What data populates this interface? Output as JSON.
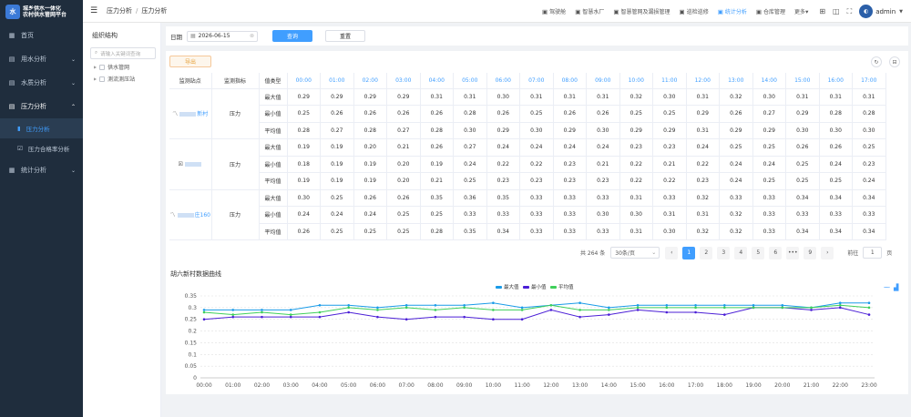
{
  "app": {
    "title_line1": "城乡供水一体化",
    "title_line2": "农村供水管网平台",
    "logo_mark": "水"
  },
  "sidebar": {
    "items": [
      {
        "label": "首页",
        "icon": "home-icon",
        "glyph": "▦"
      },
      {
        "label": "用水分析",
        "icon": "water-icon",
        "glyph": "▤"
      },
      {
        "label": "水质分析",
        "icon": "quality-icon",
        "glyph": "▤"
      },
      {
        "label": "压力分析",
        "icon": "pressure-icon",
        "glyph": "▤"
      },
      {
        "label": "统计分析",
        "icon": "stats-icon",
        "glyph": "▦"
      }
    ],
    "subitems": [
      {
        "label": "压力分析",
        "glyph": "▮"
      },
      {
        "label": "压力合格率分析",
        "glyph": "☑"
      }
    ]
  },
  "topbar": {
    "breadcrumb": [
      "压力分析",
      "压力分析"
    ],
    "nav": [
      {
        "label": "驾驶舱",
        "glyph": "▣"
      },
      {
        "label": "智慧水厂",
        "glyph": "▣"
      },
      {
        "label": "智慧管网及漏损管理",
        "glyph": "▣"
      },
      {
        "label": "巡检巡修",
        "glyph": "▣"
      },
      {
        "label": "统计分析",
        "glyph": "▣"
      },
      {
        "label": "仓库管理",
        "glyph": "▣"
      },
      {
        "label": "更多",
        "glyph": "▾"
      }
    ],
    "user": "admin"
  },
  "tree": {
    "title": "组织结构",
    "search_placeholder": "请输入关键词查询",
    "nodes": [
      "供水管网",
      "测流测压站"
    ]
  },
  "filter": {
    "date_label": "日期",
    "date_value": "2026-06-15",
    "query": "查询",
    "reset": "重置"
  },
  "table": {
    "export": "导出",
    "headers": [
      "监测站点",
      "监测指标",
      "值类型"
    ],
    "hours": [
      "00:00",
      "01:00",
      "02:00",
      "03:00",
      "04:00",
      "05:00",
      "06:00",
      "07:00",
      "08:00",
      "09:00",
      "10:00",
      "11:00",
      "12:00",
      "13:00",
      "14:00",
      "15:00",
      "16:00",
      "17:00"
    ],
    "groups": [
      {
        "site": "新村",
        "metric": "压力",
        "rows": [
          {
            "type": "最大值",
            "values": [
              "0.29",
              "0.29",
              "0.29",
              "0.29",
              "0.31",
              "0.31",
              "0.30",
              "0.31",
              "0.31",
              "0.31",
              "0.32",
              "0.30",
              "0.31",
              "0.32",
              "0.30",
              "0.31",
              "0.31",
              "0.31"
            ]
          },
          {
            "type": "最小值",
            "values": [
              "0.25",
              "0.26",
              "0.26",
              "0.26",
              "0.26",
              "0.28",
              "0.26",
              "0.25",
              "0.26",
              "0.26",
              "0.25",
              "0.25",
              "0.29",
              "0.26",
              "0.27",
              "0.29",
              "0.28",
              "0.28"
            ]
          },
          {
            "type": "平均值",
            "values": [
              "0.28",
              "0.27",
              "0.28",
              "0.27",
              "0.28",
              "0.30",
              "0.29",
              "0.30",
              "0.29",
              "0.30",
              "0.29",
              "0.29",
              "0.31",
              "0.29",
              "0.29",
              "0.30",
              "0.30",
              "0.30"
            ]
          }
        ]
      },
      {
        "site": "",
        "metric": "压力",
        "rows": [
          {
            "type": "最大值",
            "values": [
              "0.19",
              "0.19",
              "0.20",
              "0.21",
              "0.26",
              "0.27",
              "0.24",
              "0.24",
              "0.24",
              "0.24",
              "0.23",
              "0.23",
              "0.24",
              "0.25",
              "0.25",
              "0.26",
              "0.26",
              "0.25"
            ]
          },
          {
            "type": "最小值",
            "values": [
              "0.18",
              "0.19",
              "0.19",
              "0.20",
              "0.19",
              "0.24",
              "0.22",
              "0.22",
              "0.23",
              "0.21",
              "0.22",
              "0.21",
              "0.22",
              "0.24",
              "0.24",
              "0.25",
              "0.24",
              "0.23"
            ]
          },
          {
            "type": "平均值",
            "values": [
              "0.19",
              "0.19",
              "0.19",
              "0.20",
              "0.21",
              "0.25",
              "0.23",
              "0.23",
              "0.23",
              "0.23",
              "0.22",
              "0.22",
              "0.23",
              "0.24",
              "0.25",
              "0.25",
              "0.25",
              "0.24"
            ]
          }
        ]
      },
      {
        "site": "庄160",
        "metric": "压力",
        "rows": [
          {
            "type": "最大值",
            "values": [
              "0.30",
              "0.25",
              "0.26",
              "0.26",
              "0.35",
              "0.36",
              "0.35",
              "0.33",
              "0.33",
              "0.33",
              "0.31",
              "0.33",
              "0.32",
              "0.33",
              "0.33",
              "0.34",
              "0.34",
              "0.34"
            ]
          },
          {
            "type": "最小值",
            "values": [
              "0.24",
              "0.24",
              "0.24",
              "0.25",
              "0.25",
              "0.33",
              "0.33",
              "0.33",
              "0.33",
              "0.30",
              "0.30",
              "0.31",
              "0.31",
              "0.32",
              "0.33",
              "0.33",
              "0.33",
              "0.33"
            ]
          },
          {
            "type": "平均值",
            "values": [
              "0.26",
              "0.25",
              "0.25",
              "0.25",
              "0.28",
              "0.35",
              "0.34",
              "0.33",
              "0.33",
              "0.33",
              "0.31",
              "0.30",
              "0.32",
              "0.32",
              "0.33",
              "0.34",
              "0.34",
              "0.34"
            ]
          }
        ]
      }
    ]
  },
  "pager": {
    "total": "共 264 条",
    "page_size": "30条/页",
    "pages": [
      "1",
      "2",
      "3",
      "4",
      "5",
      "6",
      "•••",
      "9"
    ],
    "goto_label": "前往",
    "goto_value": "1",
    "goto_suffix": "页",
    "prev": "‹",
    "next": "›"
  },
  "chart": {
    "title": "胡六新村数据曲线"
  },
  "chart_data": {
    "type": "line",
    "title": "胡六新村数据曲线",
    "x": [
      "00:00",
      "01:00",
      "02:00",
      "03:00",
      "04:00",
      "05:00",
      "06:00",
      "07:00",
      "08:00",
      "09:00",
      "10:00",
      "11:00",
      "12:00",
      "13:00",
      "14:00",
      "15:00",
      "16:00",
      "17:00",
      "18:00",
      "19:00",
      "20:00",
      "21:00",
      "22:00",
      "23:00"
    ],
    "ylim": [
      0,
      0.35
    ],
    "yticks": [
      "0",
      "0.05",
      "0.1",
      "0.15",
      "0.2",
      "0.25",
      "0.3",
      "0.35"
    ],
    "legend_position": "top-center",
    "grid": true,
    "series": [
      {
        "name": "最大值",
        "color": "#1a9be8",
        "values": [
          0.29,
          0.29,
          0.29,
          0.29,
          0.31,
          0.31,
          0.3,
          0.31,
          0.31,
          0.31,
          0.32,
          0.3,
          0.31,
          0.32,
          0.3,
          0.31,
          0.31,
          0.31,
          0.31,
          0.31,
          0.31,
          0.3,
          0.32,
          0.32
        ]
      },
      {
        "name": "最小值",
        "color": "#4b1fd6",
        "values": [
          0.25,
          0.26,
          0.26,
          0.26,
          0.26,
          0.28,
          0.26,
          0.25,
          0.26,
          0.26,
          0.25,
          0.25,
          0.29,
          0.26,
          0.27,
          0.29,
          0.28,
          0.28,
          0.27,
          0.3,
          0.3,
          0.29,
          0.3,
          0.27
        ]
      },
      {
        "name": "平均值",
        "color": "#3fcf5a",
        "values": [
          0.28,
          0.27,
          0.28,
          0.27,
          0.28,
          0.3,
          0.29,
          0.3,
          0.29,
          0.3,
          0.29,
          0.29,
          0.31,
          0.29,
          0.29,
          0.3,
          0.3,
          0.3,
          0.3,
          0.3,
          0.3,
          0.3,
          0.31,
          0.3
        ]
      }
    ]
  }
}
